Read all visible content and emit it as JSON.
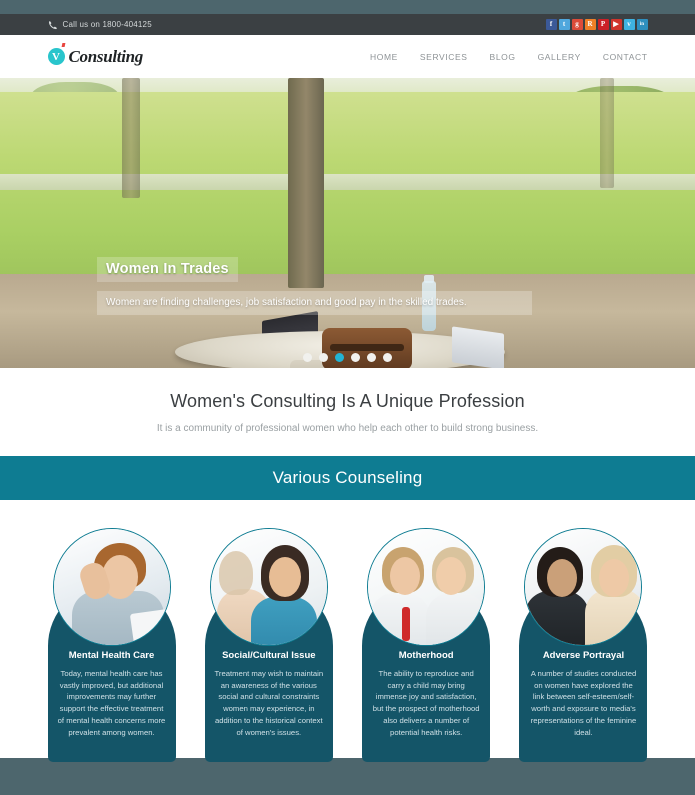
{
  "topbar": {
    "phone_icon": "phone-icon",
    "call_text": "Call us on  1800-404125",
    "socials": [
      {
        "name": "facebook",
        "glyph": "f",
        "color": "#3b5998"
      },
      {
        "name": "twitter",
        "glyph": "t",
        "color": "#4fa7dd"
      },
      {
        "name": "google-plus",
        "glyph": "g",
        "color": "#dd4b39"
      },
      {
        "name": "rss",
        "glyph": "R",
        "color": "#ef7f26"
      },
      {
        "name": "pinterest",
        "glyph": "P",
        "color": "#cb2027"
      },
      {
        "name": "youtube",
        "glyph": "▶",
        "color": "#d0342c"
      },
      {
        "name": "vimeo",
        "glyph": "v",
        "color": "#3eb2e0"
      },
      {
        "name": "linkedin",
        "glyph": "in",
        "color": "#2e8fbe"
      }
    ]
  },
  "header": {
    "logo_mark": "V",
    "logo_text": "Consulting",
    "nav": [
      {
        "label": "HOME"
      },
      {
        "label": "SERVICES"
      },
      {
        "label": "BLOG"
      },
      {
        "label": "GALLERY"
      },
      {
        "label": "CONTACT"
      }
    ]
  },
  "hero": {
    "title": "Women In Trades",
    "subtitle": "Women are finding challenges, job satisfaction and good pay in the skilled trades.",
    "slide_count": 6,
    "active_slide": 3
  },
  "intro": {
    "heading": "Women's Consulting Is A Unique Profession",
    "subheading": "It is a community of professional women who help each other to build strong business."
  },
  "banner": {
    "heading": "Various Counseling"
  },
  "cards": [
    {
      "title": "Mental Health Care",
      "text": "Today, mental health care has vastly improved, but additional improvements may further support the effective treatment of mental health concerns more prevalent among women."
    },
    {
      "title": "Social/Cultural Issue",
      "text": "Treatment may wish to maintain an awareness of the various social and cultural constraints women may experience, in addition to the historical context of women's issues."
    },
    {
      "title": "Motherhood",
      "text": "The ability to reproduce and carry a child may bring immense joy and satisfaction, but the prospect of motherhood also delivers a number of potential health risks."
    },
    {
      "title": "Adverse Portrayal",
      "text": "A number of studies conducted on women have explored the link between self-esteem/self-worth and exposure to media's representations of the feminine ideal."
    }
  ],
  "colors": {
    "page_bg": "#4d666d",
    "topbar_bg": "#3b4043",
    "accent_teal": "#0e7c92",
    "card_bg": "#145568",
    "accent_cyan": "#22b4d4",
    "logo_teal": "#29c5cc"
  }
}
